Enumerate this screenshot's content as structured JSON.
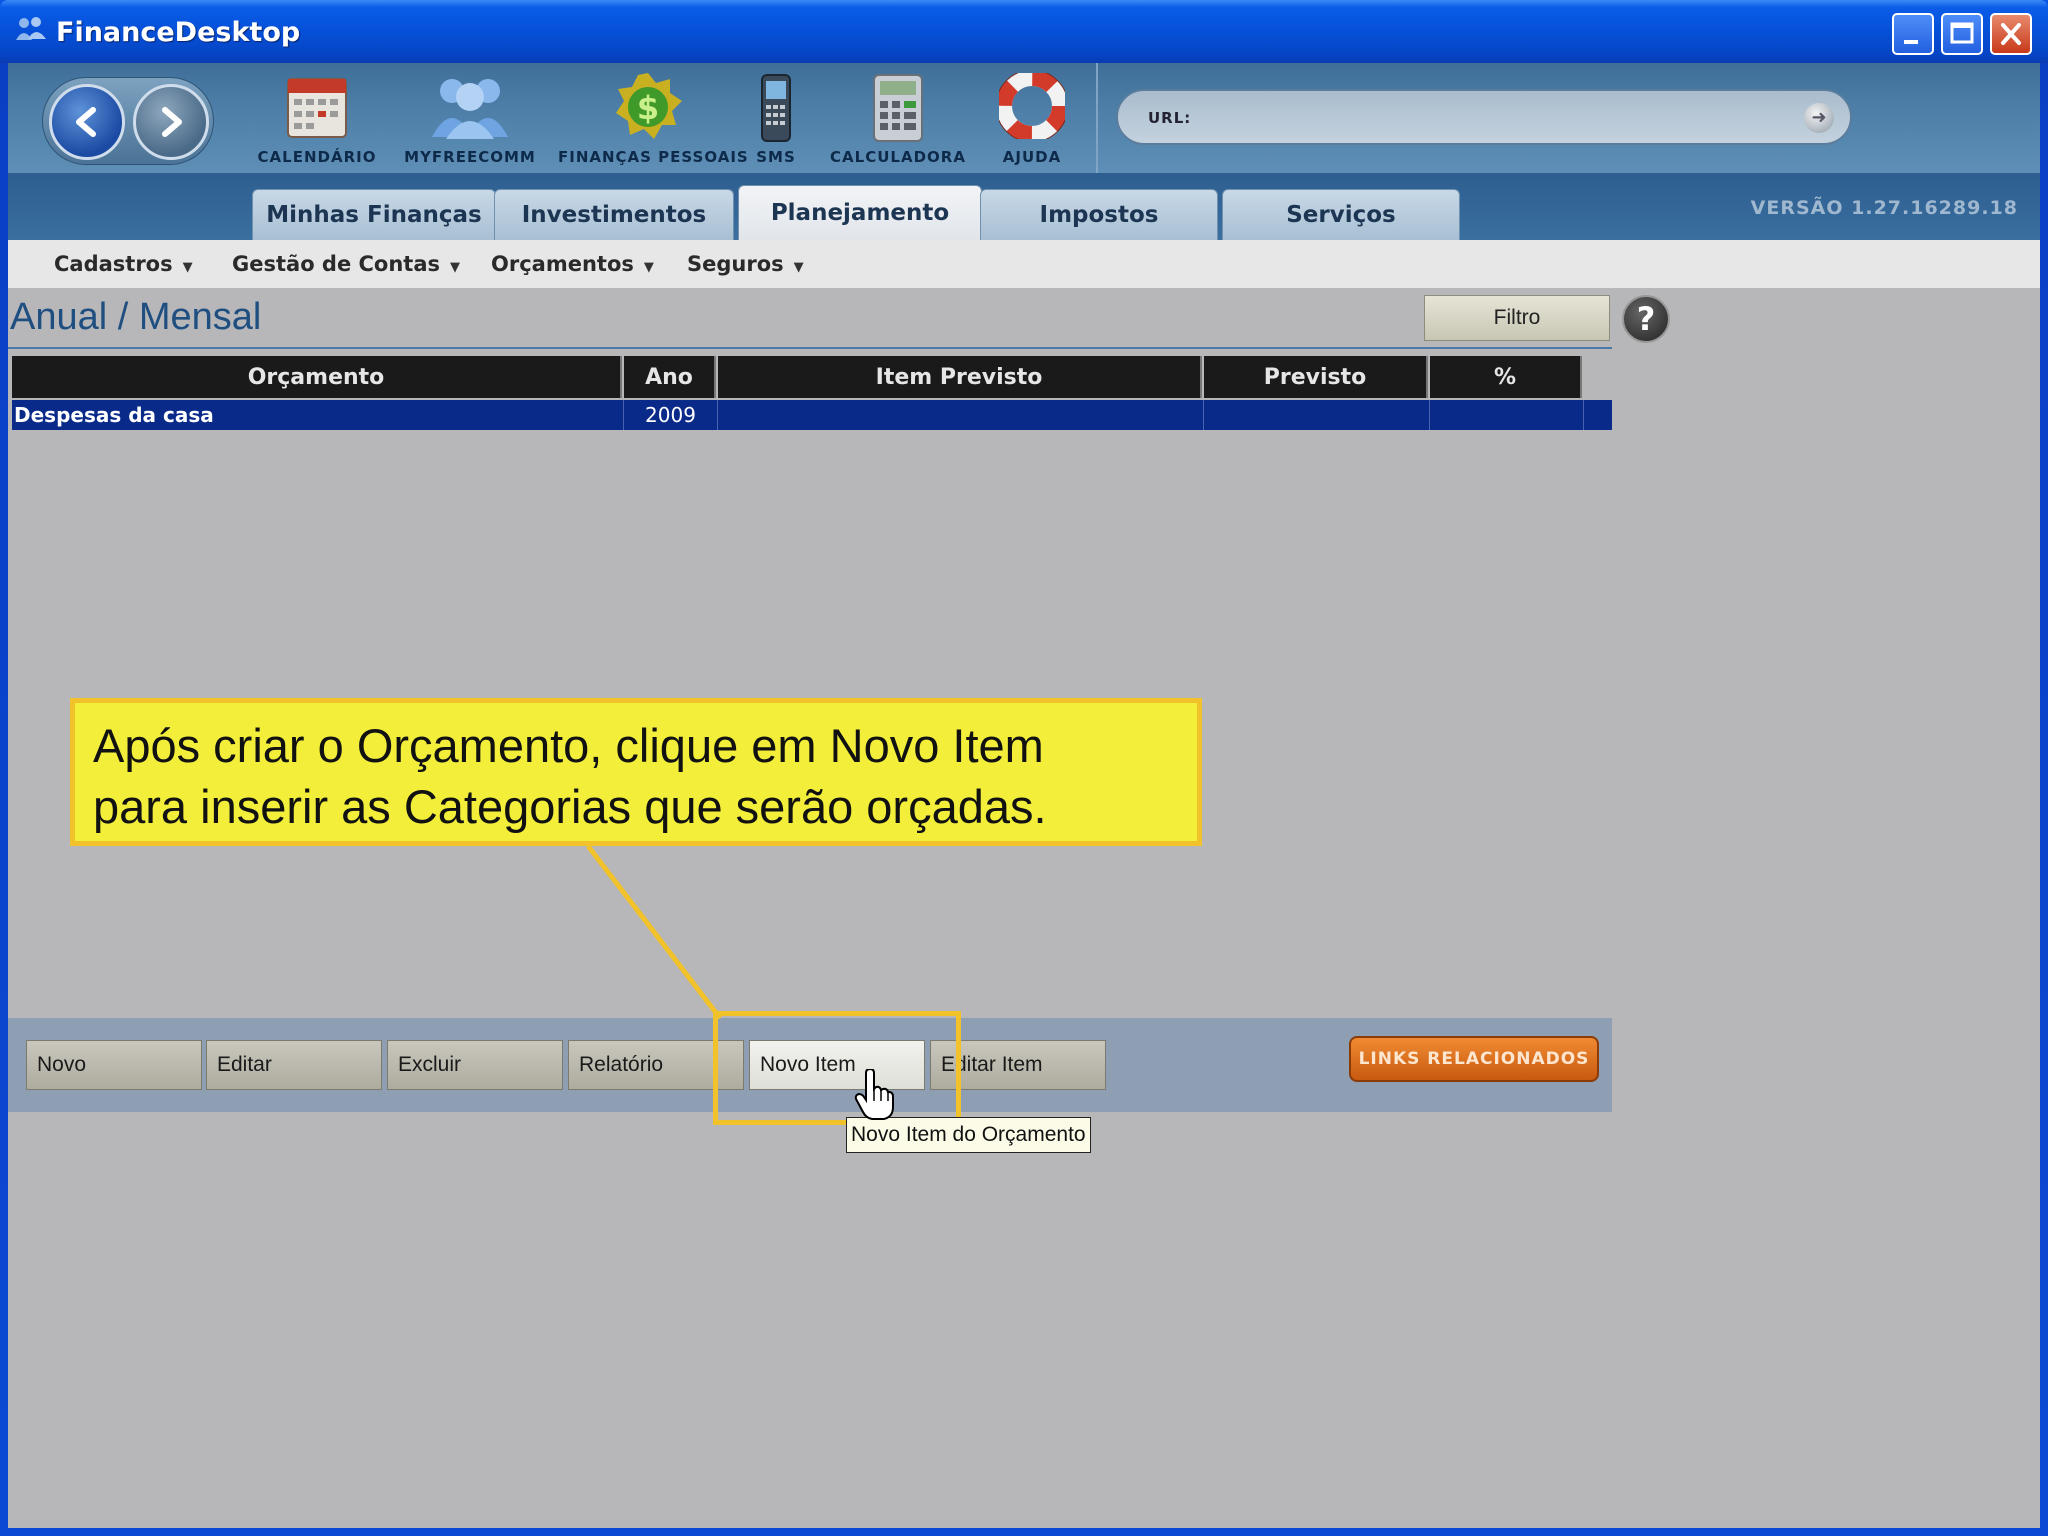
{
  "window": {
    "title": "FinanceDesktop"
  },
  "toolbar": {
    "items": [
      {
        "label": "CALENDÁRIO",
        "icon": "calendar-icon"
      },
      {
        "label": "MYFREECOMM",
        "icon": "people-icon"
      },
      {
        "label": "FINANÇAS PESSOAIS",
        "icon": "money-seal-icon"
      },
      {
        "label": "SMS",
        "icon": "cellphone-icon"
      },
      {
        "label": "CALCULADORA",
        "icon": "calculator-icon"
      },
      {
        "label": "AJUDA",
        "icon": "lifebuoy-icon"
      }
    ],
    "url_label": "URL:"
  },
  "tabs": [
    {
      "label": "Minhas Finanças",
      "active": false
    },
    {
      "label": "Investimentos",
      "active": false
    },
    {
      "label": "Planejamento",
      "active": true
    },
    {
      "label": "Impostos",
      "active": false
    },
    {
      "label": "Serviços",
      "active": false
    }
  ],
  "version": "VERSÃO 1.27.16289.18",
  "submenu": [
    "Cadastros",
    "Gestão de Contas",
    "Orçamentos",
    "Seguros"
  ],
  "page": {
    "title": "Anual / Mensal",
    "filter_label": "Filtro",
    "help_glyph": "?"
  },
  "grid": {
    "columns": [
      "Orçamento",
      "Ano",
      "Item Previsto",
      "Previsto",
      "%"
    ],
    "rows": [
      {
        "orcamento": "Despesas da casa",
        "ano": "2009",
        "item": "",
        "previsto": "",
        "pct": ""
      }
    ]
  },
  "actions": {
    "buttons": [
      "Novo",
      "Editar",
      "Excluir",
      "Relatório",
      "Novo Item",
      "Editar Item"
    ],
    "links_label": "LINKS RELACIONADOS",
    "tooltip": "Novo Item do Orçamento"
  },
  "callout": {
    "line1": "Após criar o Orçamento, clique em Novo Item",
    "line2": "para inserir as Categorias que serão orçadas."
  },
  "colors": {
    "accent": "#0a2a8a",
    "callout_fill": "#f2ee3a",
    "callout_border": "#f2c22a",
    "links_button": "#e07020"
  }
}
